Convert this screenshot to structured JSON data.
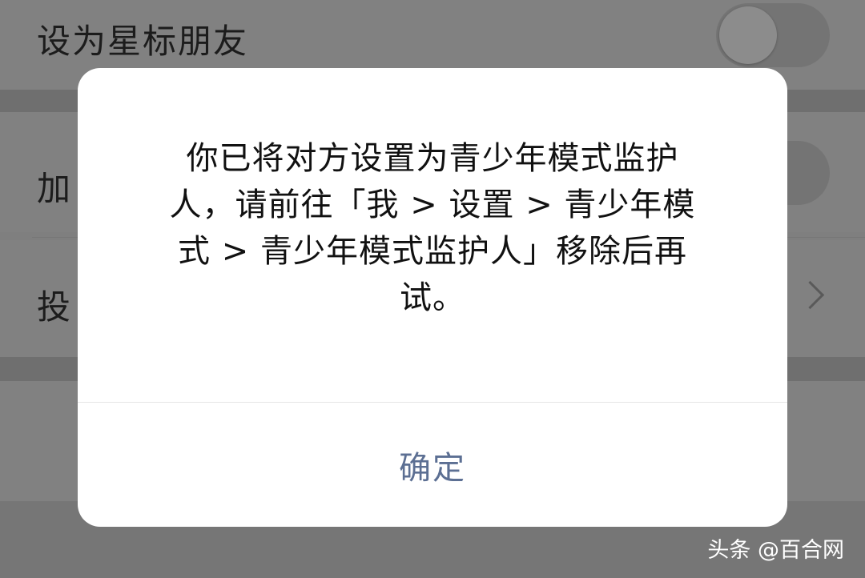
{
  "background": {
    "rows": [
      {
        "label": "设为星标朋友",
        "control": "toggle",
        "toggle_on": false
      },
      {
        "label": "加",
        "control": "toggle",
        "toggle_on": false
      },
      {
        "label": "投",
        "control": "chevron"
      }
    ]
  },
  "dialog": {
    "message_lines": [
      "你已将对方设置为青少年模式监护",
      "人，请前往「我 > 设置 > 青少年模",
      "式 > 青少年模式监护人」移除后再",
      "试。"
    ],
    "confirm_label": "确定"
  },
  "watermark": "头条 @百合网",
  "colors": {
    "overlay_background": "#7f7f7f",
    "dialog_background": "#ffffff",
    "message_text": "#111111",
    "button_text": "#5c6f93",
    "watermark_text": "#ffffff"
  }
}
